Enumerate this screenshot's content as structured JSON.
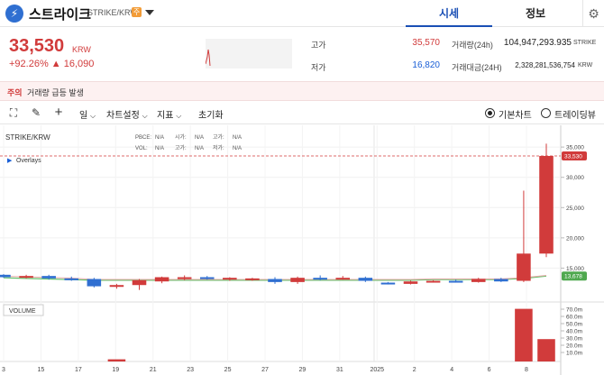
{
  "header": {
    "coin_name": "스트라이크",
    "pair": "STRIKE/KRW",
    "badge": "주",
    "tabs": [
      "시세",
      "정보"
    ]
  },
  "price": {
    "current": "33,530",
    "unit": "KRW",
    "change_pct": "+92.26%",
    "change_abs": "▲ 16,090"
  },
  "stats": {
    "high_label": "고가",
    "high_value": "35,570",
    "low_label": "저가",
    "low_value": "16,820",
    "volume_label": "거래량(24h)",
    "volume_value": "104,947,293.935",
    "volume_unit": "STRIKE",
    "amount_label": "거래대금(24H)",
    "amount_value": "2,328,281,536,754",
    "amount_unit": "KRW"
  },
  "warning": {
    "tag": "주의",
    "text": "거래량 급등 발생"
  },
  "toolbar": {
    "period": "일",
    "chart_settings": "차트설정",
    "indicators": "지표",
    "reset": "초기화",
    "basic_chart": "기본차트",
    "tradingview": "트레이딩뷰"
  },
  "chart_info": {
    "symbol": "STRIKE/KRW",
    "overlays": "Overlays",
    "volume_label": "VOLUME",
    "row1": [
      "PBCE:",
      "N/A",
      "시가:",
      "N/A",
      "고가:",
      "N/A",
      "종가:",
      "N/A"
    ],
    "row2": [
      "VOL:",
      "N/A",
      "고가:",
      "N/A",
      "저가:",
      "N/A"
    ],
    "last_price_tag": "33,530",
    "ma_tag": "13,678"
  },
  "chart_data": {
    "type": "candlestick",
    "x_ticks": [
      "3",
      "15",
      "17",
      "19",
      "21",
      "23",
      "25",
      "27",
      "29",
      "31",
      "2025",
      "2",
      "4",
      "6",
      "8"
    ],
    "y_ticks": [
      "35,000",
      "30,000",
      "25,000",
      "20,000",
      "15,000"
    ],
    "volume_ticks": [
      "70.0m",
      "60.0m",
      "50.0m",
      "40.0m",
      "30.0m",
      "20.0m",
      "10.0m"
    ],
    "ylim": [
      10000,
      38000
    ],
    "volume_ylim": [
      0,
      75
    ],
    "candles": [
      {
        "o": 13900,
        "h": 14000,
        "l": 13400,
        "c": 13500
      },
      {
        "o": 13500,
        "h": 13900,
        "l": 13300,
        "c": 13700
      },
      {
        "o": 13700,
        "h": 13900,
        "l": 13100,
        "c": 13300
      },
      {
        "o": 13300,
        "h": 13600,
        "l": 12900,
        "c": 13200
      },
      {
        "o": 13200,
        "h": 13400,
        "l": 11800,
        "c": 12000
      },
      {
        "o": 12000,
        "h": 12400,
        "l": 11600,
        "c": 12200
      },
      {
        "o": 12200,
        "h": 13200,
        "l": 11400,
        "c": 13000
      },
      {
        "o": 12800,
        "h": 13600,
        "l": 12500,
        "c": 13500
      },
      {
        "o": 13300,
        "h": 13800,
        "l": 13000,
        "c": 13500
      },
      {
        "o": 13500,
        "h": 13700,
        "l": 13100,
        "c": 13200
      },
      {
        "o": 13200,
        "h": 13500,
        "l": 12900,
        "c": 13400
      },
      {
        "o": 13200,
        "h": 13400,
        "l": 12900,
        "c": 13300
      },
      {
        "o": 13200,
        "h": 13500,
        "l": 12400,
        "c": 12700
      },
      {
        "o": 12700,
        "h": 13600,
        "l": 12400,
        "c": 13400
      },
      {
        "o": 13400,
        "h": 13800,
        "l": 13000,
        "c": 13300
      },
      {
        "o": 13300,
        "h": 13700,
        "l": 13100,
        "c": 13400
      },
      {
        "o": 13400,
        "h": 13600,
        "l": 12700,
        "c": 12900
      },
      {
        "o": 12600,
        "h": 12700,
        "l": 12300,
        "c": 12400
      },
      {
        "o": 12400,
        "h": 12900,
        "l": 12300,
        "c": 12800
      },
      {
        "o": 12800,
        "h": 13000,
        "l": 12600,
        "c": 12900
      },
      {
        "o": 12900,
        "h": 13100,
        "l": 12600,
        "c": 12700
      },
      {
        "o": 12700,
        "h": 13400,
        "l": 12600,
        "c": 13200
      },
      {
        "o": 13200,
        "h": 13400,
        "l": 12700,
        "c": 12800
      },
      {
        "o": 12900,
        "h": 27800,
        "l": 12700,
        "c": 17400
      },
      {
        "o": 17400,
        "h": 35570,
        "l": 16820,
        "c": 33530
      }
    ],
    "volumes": [
      0,
      0,
      0,
      0,
      0,
      0.5,
      0,
      0,
      0,
      0,
      0,
      0,
      0,
      0,
      0,
      0,
      0,
      0,
      0,
      0,
      0,
      0,
      0,
      70.5,
      28.5
    ],
    "ma_line": [
      13400,
      13300,
      13200,
      13100,
      13000,
      13000,
      13000,
      13000,
      13000,
      13000,
      13000,
      13000,
      13000,
      13000,
      13000,
      13000,
      13000,
      13000,
      13000,
      13100,
      13100,
      13100,
      13100,
      13300,
      13678
    ]
  },
  "colors": {
    "up": "#d13b3b",
    "down": "#2f6fd1",
    "accent": "#1a4fb5",
    "ma": "#66c26d"
  }
}
